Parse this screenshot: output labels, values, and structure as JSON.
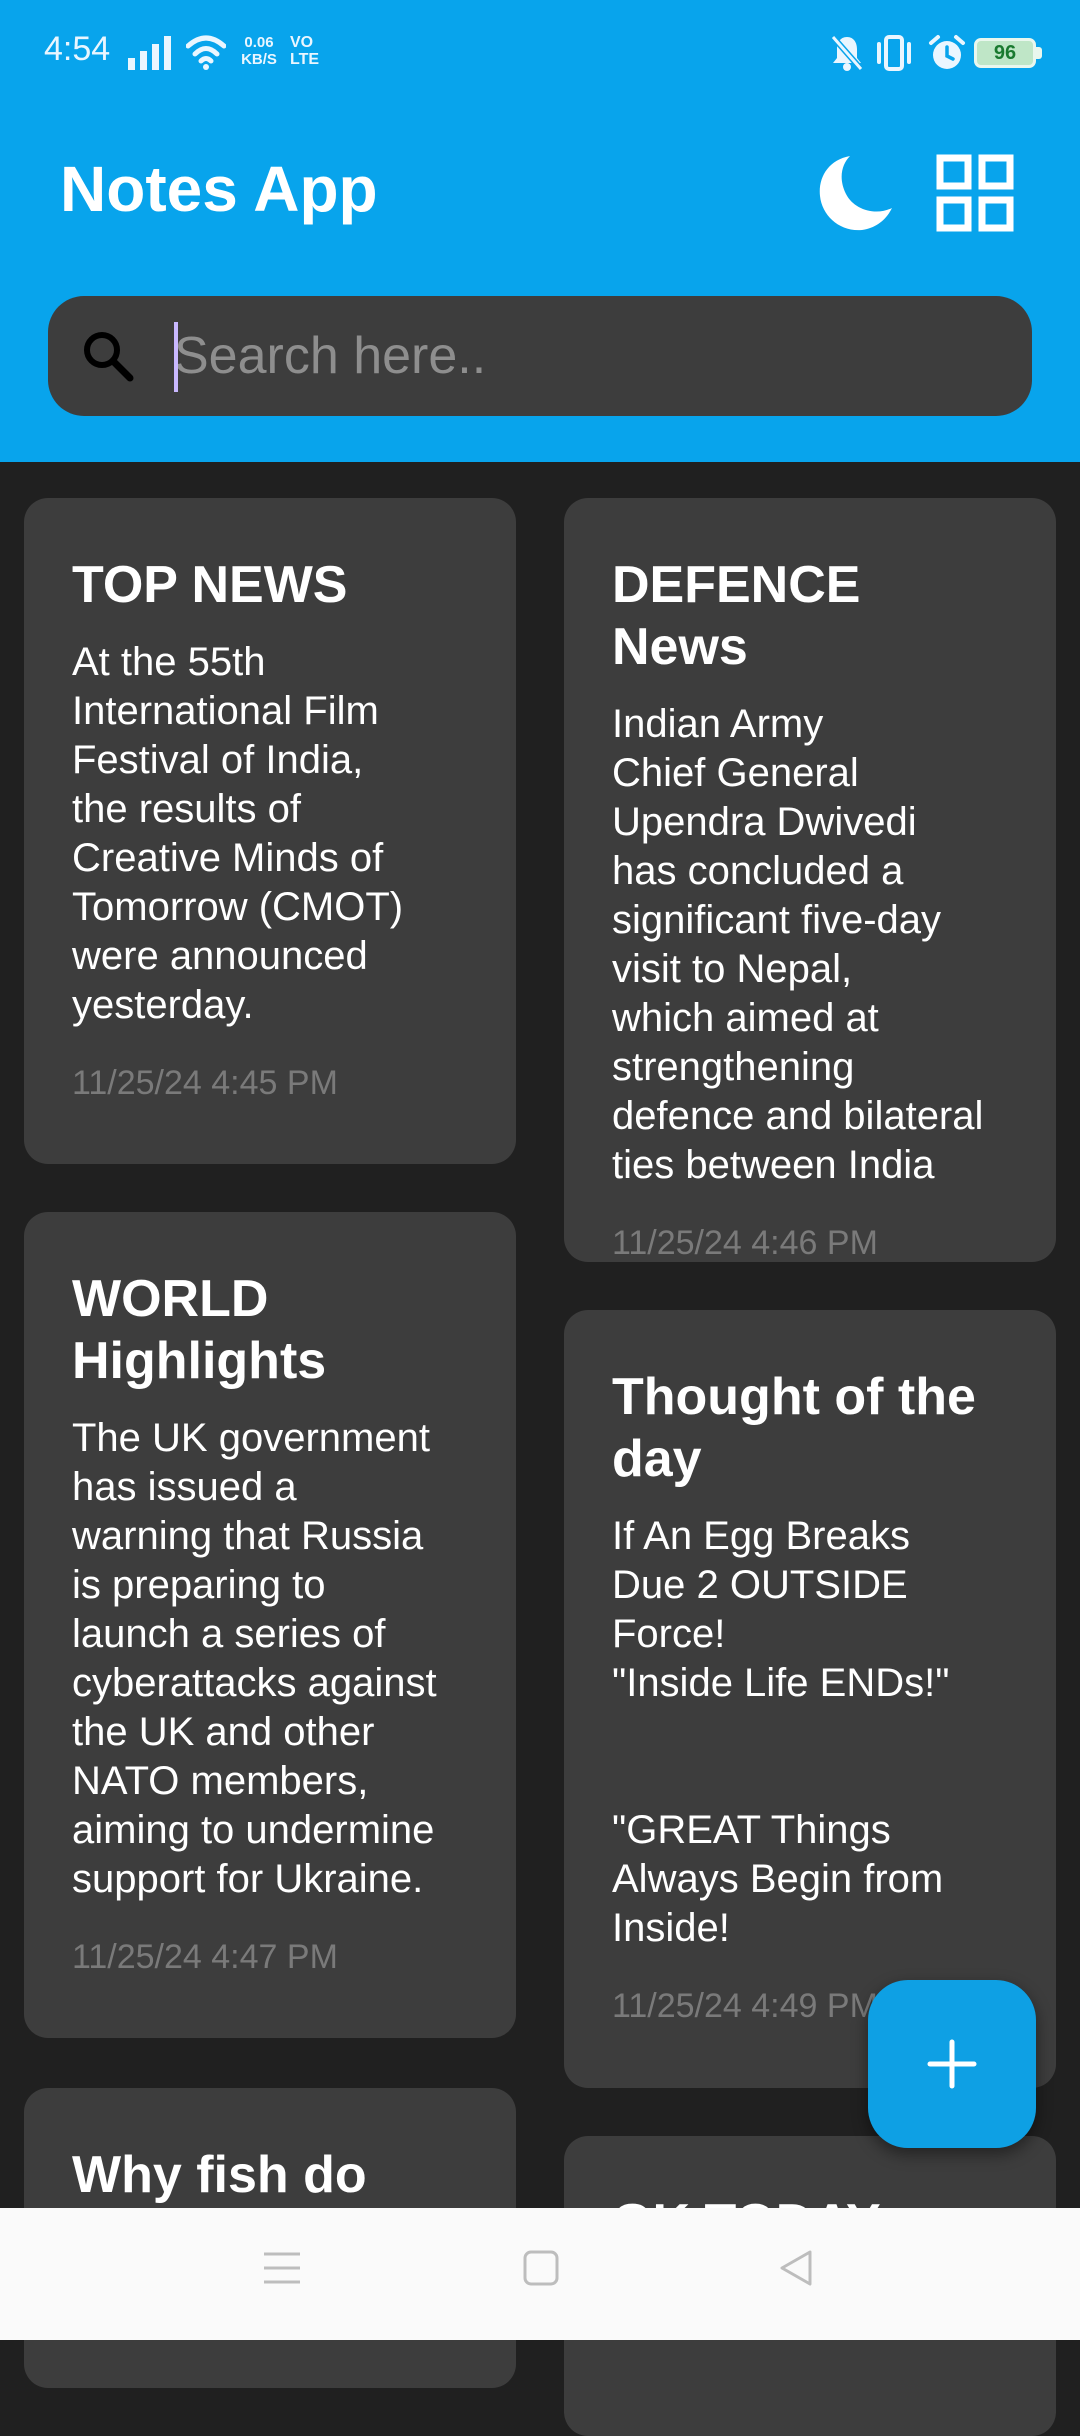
{
  "status_bar": {
    "time": "4:54",
    "net_speed_value": "0.06",
    "net_speed_unit": "KB/S",
    "volte_top": "VO",
    "volte_bottom": "LTE",
    "battery": "96",
    "icons": [
      "signal-icon",
      "wifi-icon",
      "mute-icon",
      "vibrate-icon",
      "alarm-icon",
      "battery-icon"
    ]
  },
  "header": {
    "title": "Notes App",
    "theme_icon": "moon-icon",
    "layout_icon": "grid-view-icon",
    "background_color": "#08A4EC"
  },
  "search": {
    "placeholder": "Search here..",
    "value": ""
  },
  "notes": [
    {
      "title": "TOP NEWS",
      "body": "At the 55th\nInternational Film\nFestival of India,\nthe results of\nCreative Minds of\nTomorrow (CMOT)\nwere announced\nyesterday.",
      "date": "11/25/24 4:45 PM"
    },
    {
      "title": "DEFENCE News",
      "body": "Indian Army\nChief General\nUpendra Dwivedi\nhas concluded a\nsignificant five-day\nvisit to Nepal,\nwhich aimed at\nstrengthening\ndefence and bilateral\nties between India",
      "date": "11/25/24 4:46 PM"
    },
    {
      "title": "WORLD\nHighlights",
      "body": "The UK government\nhas issued a\nwarning that Russia\nis preparing to\nlaunch a series of\ncyberattacks against\nthe UK and other\nNATO members,\naiming to undermine\nsupport for Ukraine.",
      "date": "11/25/24 4:47 PM"
    },
    {
      "title": "Thought of the\nday",
      "body": " If An Egg Breaks\nDue 2 OUTSIDE\nForce!\n\"Inside Life ENDs!\"\n\n\n\"GREAT Things\nAlways Begin from\nInside!",
      "date": "11/25/24 4:49 PM"
    },
    {
      "title": "Why fish do",
      "body": "",
      "date": ""
    },
    {
      "title": "GK TODAY",
      "body": "",
      "date": ""
    }
  ],
  "fab": {
    "icon": "plus-icon",
    "color": "#0EA0E4"
  },
  "nav_bar": {
    "icons": [
      "menu-icon",
      "home-square-icon",
      "back-triangle-icon"
    ]
  }
}
